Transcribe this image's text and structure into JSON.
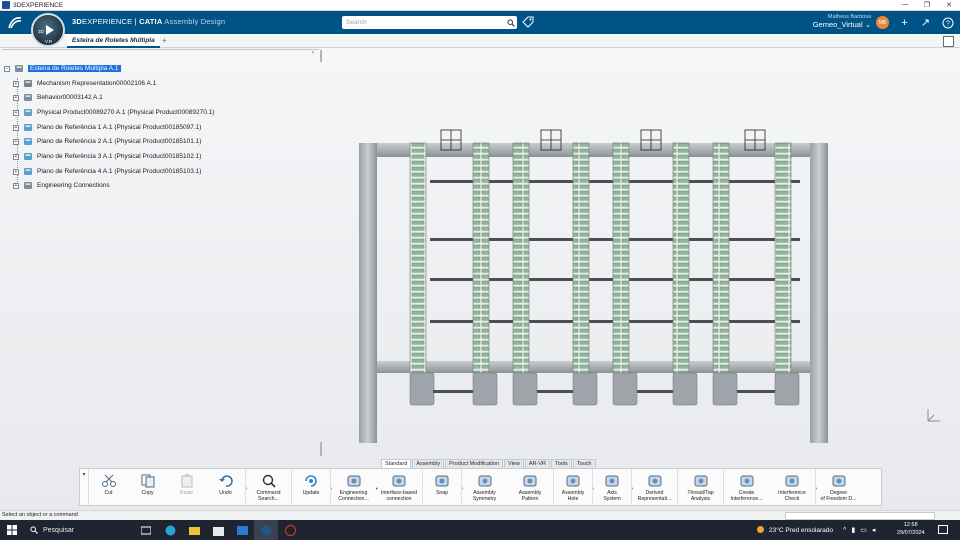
{
  "os_title": {
    "app_name": "3DEXPERIENCE",
    "minimize": "—",
    "restore": "❐",
    "close": "✕"
  },
  "topbar": {
    "brand_3d": "3D",
    "brand_experience": "EXPERIENCE",
    "brand_separator": " | ",
    "brand_catia": "CATIA",
    "brand_app": " Assembly Design",
    "search_placeholder": "Search",
    "user_name": "Matheus Barbosa",
    "user_role": "Gemeo_Virtual",
    "avatar_initials": "MB",
    "add_icon": "+",
    "share_icon": "↗",
    "help_icon": "?",
    "accent": "#005386"
  },
  "compass": {
    "label": "3D",
    "version": "V.R"
  },
  "tabs": {
    "active_label": "Esteira de Roletes Múltipla",
    "add_label": "+"
  },
  "tree": {
    "collapse_label": "‹",
    "items": [
      {
        "label": "Esteira de Roletes Múltipla A.1",
        "selected": true,
        "icon": "product-root-icon"
      },
      {
        "label": "Mechanism Representation00002106 A.1",
        "icon": "mechanism-icon"
      },
      {
        "label": "Behavior00003142 A.1",
        "icon": "behavior-icon"
      },
      {
        "label": "Physical Product00089270 A.1 (Physical Product00089270.1)",
        "icon": "physical-product-icon"
      },
      {
        "label": "Plano de Referência 1 A.1 (Physical Product00185097.1)",
        "icon": "part-icon"
      },
      {
        "label": "Plano de Referência 2 A.1 (Physical Product00185101.1)",
        "icon": "part-icon"
      },
      {
        "label": "Plano de Referência 3 A.1 (Physical Product00185102.1)",
        "icon": "part-icon"
      },
      {
        "label": "Plano de Referência 4 A.1 (Physical Product00185103.1)",
        "icon": "part-icon"
      },
      {
        "label": "Engineering Connections",
        "icon": "engineering-connections-icon"
      }
    ]
  },
  "section_tabs": [
    "Standard",
    "Assembly",
    "Product Modification",
    "View",
    "AR-VR",
    "Tools",
    "Touch"
  ],
  "toolbar": {
    "more_label": "▾",
    "tools": [
      {
        "label": "Cut",
        "icon": "scissors-icon"
      },
      {
        "label": "Copy",
        "icon": "copy-icon"
      },
      {
        "label": "Paste",
        "icon": "paste-icon",
        "disabled": true
      },
      {
        "label": "Undo",
        "icon": "undo-icon"
      },
      {
        "label": "Command\nSearch...",
        "icon": "command-search-icon"
      },
      {
        "label": "Update",
        "icon": "update-icon"
      },
      {
        "label": "Engineering\nConnection...",
        "icon": "engineering-connection-icon"
      },
      {
        "label": "Interface-based\nconnection",
        "icon": "interface-connection-icon"
      },
      {
        "label": "Snap",
        "icon": "snap-icon"
      },
      {
        "label": "Assembly\nSymmetry",
        "icon": "assembly-symmetry-icon"
      },
      {
        "label": "Assembly\nPattern",
        "icon": "assembly-pattern-icon"
      },
      {
        "label": "Assembly\nHole",
        "icon": "assembly-hole-icon"
      },
      {
        "label": "Axis\nSystem",
        "icon": "axis-system-icon"
      },
      {
        "label": "Derived\nRepresentati...",
        "icon": "derived-representation-icon"
      },
      {
        "label": "Thread/Tap\nAnalysis",
        "icon": "thread-tap-icon"
      },
      {
        "label": "Create\nInterference...",
        "icon": "create-interference-icon"
      },
      {
        "label": "Interference\nCheck",
        "icon": "interference-check-icon"
      },
      {
        "label": "Degree\nof Freedom D...",
        "icon": "degree-of-freedom-icon"
      }
    ]
  },
  "status": {
    "message": "Select an object or a command"
  },
  "taskbar": {
    "search_label": "Pesquisar",
    "weather": "23°C  Pred ensolarado",
    "time": "12:58",
    "date": "29/07/2024"
  }
}
